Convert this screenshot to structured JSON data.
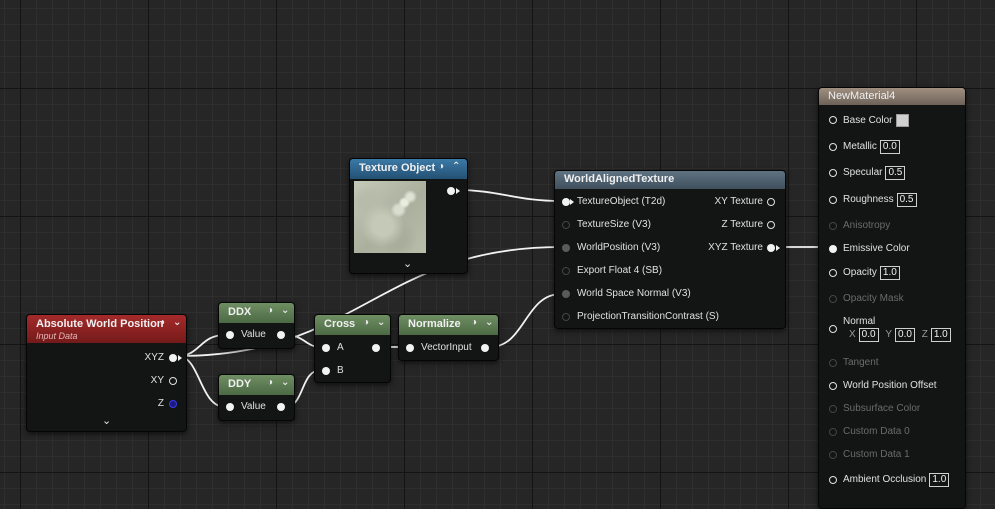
{
  "nodes": {
    "absolute_world_position": {
      "title": "Absolute World Position",
      "subtitle": "Input Data",
      "outputs": [
        "XYZ",
        "XY",
        "Z"
      ]
    },
    "ddx": {
      "title": "DDX",
      "input": "Value"
    },
    "ddy": {
      "title": "DDY",
      "input": "Value"
    },
    "cross": {
      "title": "Cross",
      "inputs": [
        "A",
        "B"
      ]
    },
    "normalize": {
      "title": "Normalize",
      "input": "VectorInput"
    },
    "texture_object": {
      "title": "Texture Object"
    },
    "world_aligned_texture": {
      "title": "WorldAlignedTexture",
      "inputs": [
        "TextureObject (T2d)",
        "TextureSize (V3)",
        "WorldPosition (V3)",
        "Export Float 4 (SB)",
        "World Space Normal (V3)",
        "ProjectionTransitionContrast (S)"
      ],
      "outputs": [
        "XY Texture",
        "Z Texture",
        "XYZ Texture"
      ]
    },
    "material_result": {
      "title": "NewMaterial4",
      "base_color": {
        "label": "Base Color",
        "value_color": "#d0d0d0"
      },
      "metallic": {
        "label": "Metallic",
        "value": "0.0"
      },
      "specular": {
        "label": "Specular",
        "value": "0.5"
      },
      "roughness": {
        "label": "Roughness",
        "value": "0.5"
      },
      "anisotropy": {
        "label": "Anisotropy"
      },
      "emissive_color": {
        "label": "Emissive Color"
      },
      "opacity": {
        "label": "Opacity",
        "value": "1.0"
      },
      "opacity_mask": {
        "label": "Opacity Mask"
      },
      "normal": {
        "label": "Normal",
        "x_label": "X",
        "x": "0.0",
        "y_label": "Y",
        "y": "0.0",
        "z_label": "Z",
        "z": "1.0"
      },
      "tangent": {
        "label": "Tangent"
      },
      "world_position_offset": {
        "label": "World Position Offset"
      },
      "subsurface_color": {
        "label": "Subsurface Color"
      },
      "custom_data_0": {
        "label": "Custom Data 0"
      },
      "custom_data_1": {
        "label": "Custom Data 1"
      },
      "ambient_occlusion": {
        "label": "Ambient Occlusion",
        "value": "1.0"
      }
    }
  },
  "icons": {
    "preview": "eye-icon",
    "collapse": "chevron-down-icon",
    "expand": "chevron-up-icon"
  },
  "colors": {
    "input_header": "#a52a2a",
    "math_header": "#5f7f55",
    "texture_header": "#3b7aa6",
    "function_header": "#5f7383",
    "result_header": "#9f8f80",
    "wire": "#ffffff"
  }
}
